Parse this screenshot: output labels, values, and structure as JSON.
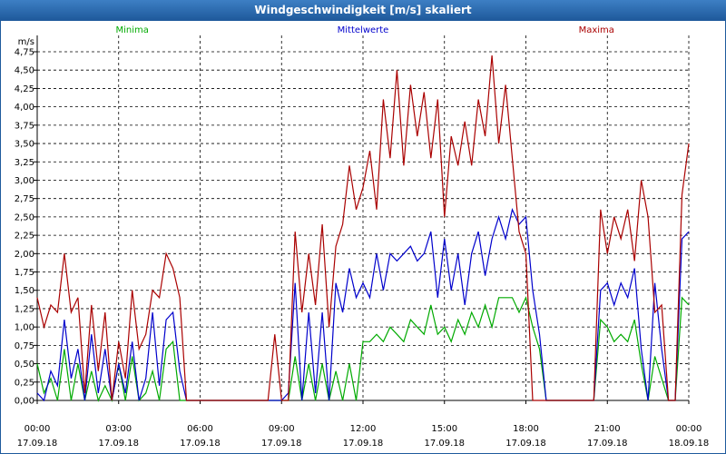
{
  "window": {
    "title": "Windgeschwindigkeit [m/s] skaliert"
  },
  "chart_data": {
    "type": "line",
    "title": "Windgeschwindigkeit [m/s] skaliert",
    "ylabel": "m/s",
    "ylim": [
      0,
      4.75
    ],
    "grid": true,
    "legend_position": "top",
    "y_ticks": [
      "0,00",
      "0,25",
      "0,50",
      "0,75",
      "1,00",
      "1,25",
      "1,50",
      "1,75",
      "2,00",
      "2,25",
      "2,50",
      "2,75",
      "3,00",
      "3,25",
      "3,50",
      "3,75",
      "4,00",
      "4,25",
      "4,50",
      "4,75"
    ],
    "x_ticks": [
      {
        "time": "00:00",
        "date": "17.09.18"
      },
      {
        "time": "03:00",
        "date": "17.09.18"
      },
      {
        "time": "06:00",
        "date": "17.09.18"
      },
      {
        "time": "09:00",
        "date": "17.09.18"
      },
      {
        "time": "12:00",
        "date": "17.09.18"
      },
      {
        "time": "15:00",
        "date": "17.09.18"
      },
      {
        "time": "18:00",
        "date": "17.09.18"
      },
      {
        "time": "21:00",
        "date": "17.09.18"
      },
      {
        "time": "00:00",
        "date": "18.09.18"
      }
    ],
    "x_range_hours": [
      0,
      24
    ],
    "series": [
      {
        "name": "Minima",
        "color": "#00aa00",
        "points": [
          [
            0,
            0.5
          ],
          [
            0.25,
            0.1
          ],
          [
            0.5,
            0.3
          ],
          [
            0.75,
            0.0
          ],
          [
            1,
            0.7
          ],
          [
            1.25,
            0.0
          ],
          [
            1.5,
            0.5
          ],
          [
            1.75,
            0.0
          ],
          [
            2,
            0.4
          ],
          [
            2.25,
            0.0
          ],
          [
            2.5,
            0.2
          ],
          [
            2.75,
            0.0
          ],
          [
            3,
            0.5
          ],
          [
            3.25,
            0.0
          ],
          [
            3.5,
            0.6
          ],
          [
            3.75,
            0.0
          ],
          [
            4,
            0.1
          ],
          [
            4.25,
            0.4
          ],
          [
            4.5,
            0.0
          ],
          [
            4.75,
            0.7
          ],
          [
            5,
            0.8
          ],
          [
            5.25,
            0.0
          ],
          [
            5.5,
            0.0
          ],
          [
            6,
            0.0
          ],
          [
            7,
            0.0
          ],
          [
            8,
            0.0
          ],
          [
            9,
            0.0
          ],
          [
            9.25,
            0.0
          ],
          [
            9.5,
            0.6
          ],
          [
            9.75,
            0.0
          ],
          [
            10,
            0.5
          ],
          [
            10.25,
            0.0
          ],
          [
            10.5,
            0.5
          ],
          [
            10.75,
            0.0
          ],
          [
            11,
            0.4
          ],
          [
            11.25,
            0.0
          ],
          [
            11.5,
            0.5
          ],
          [
            11.75,
            0.0
          ],
          [
            12,
            0.8
          ],
          [
            12.25,
            0.8
          ],
          [
            12.5,
            0.9
          ],
          [
            12.75,
            0.8
          ],
          [
            13,
            1.0
          ],
          [
            13.25,
            0.9
          ],
          [
            13.5,
            0.8
          ],
          [
            13.75,
            1.1
          ],
          [
            14,
            1.0
          ],
          [
            14.25,
            0.9
          ],
          [
            14.5,
            1.3
          ],
          [
            14.75,
            0.9
          ],
          [
            15,
            1.0
          ],
          [
            15.25,
            0.8
          ],
          [
            15.5,
            1.1
          ],
          [
            15.75,
            0.9
          ],
          [
            16,
            1.2
          ],
          [
            16.25,
            1.0
          ],
          [
            16.5,
            1.3
          ],
          [
            16.75,
            1.0
          ],
          [
            17,
            1.4
          ],
          [
            17.25,
            1.4
          ],
          [
            17.5,
            1.4
          ],
          [
            17.75,
            1.2
          ],
          [
            18,
            1.4
          ],
          [
            18.25,
            1.0
          ],
          [
            18.5,
            0.7
          ],
          [
            18.75,
            0.0
          ],
          [
            19,
            0.0
          ],
          [
            20,
            0.0
          ],
          [
            20.5,
            0.0
          ],
          [
            20.75,
            1.1
          ],
          [
            21,
            1.0
          ],
          [
            21.25,
            0.8
          ],
          [
            21.5,
            0.9
          ],
          [
            21.75,
            0.8
          ],
          [
            22,
            1.1
          ],
          [
            22.25,
            0.5
          ],
          [
            22.5,
            0.0
          ],
          [
            22.75,
            0.6
          ],
          [
            23,
            0.3
          ],
          [
            23.25,
            0.0
          ],
          [
            23.5,
            0.0
          ],
          [
            23.75,
            1.4
          ],
          [
            24,
            1.3
          ]
        ]
      },
      {
        "name": "Mittelwerte",
        "color": "#0000cc",
        "points": [
          [
            0,
            0.1
          ],
          [
            0.25,
            0.0
          ],
          [
            0.5,
            0.4
          ],
          [
            0.75,
            0.2
          ],
          [
            1,
            1.1
          ],
          [
            1.25,
            0.3
          ],
          [
            1.5,
            0.7
          ],
          [
            1.75,
            0.0
          ],
          [
            2,
            0.9
          ],
          [
            2.25,
            0.1
          ],
          [
            2.5,
            0.7
          ],
          [
            2.75,
            0.0
          ],
          [
            3,
            0.5
          ],
          [
            3.25,
            0.1
          ],
          [
            3.5,
            0.8
          ],
          [
            3.75,
            0.0
          ],
          [
            4,
            0.3
          ],
          [
            4.25,
            1.2
          ],
          [
            4.5,
            0.2
          ],
          [
            4.75,
            1.1
          ],
          [
            5,
            1.2
          ],
          [
            5.25,
            0.4
          ],
          [
            5.5,
            0.0
          ],
          [
            6,
            0.0
          ],
          [
            7,
            0.0
          ],
          [
            8,
            0.0
          ],
          [
            9,
            0.0
          ],
          [
            9.25,
            0.1
          ],
          [
            9.5,
            1.6
          ],
          [
            9.75,
            0.0
          ],
          [
            10,
            1.2
          ],
          [
            10.25,
            0.1
          ],
          [
            10.5,
            1.2
          ],
          [
            10.75,
            0.0
          ],
          [
            11,
            1.6
          ],
          [
            11.25,
            1.2
          ],
          [
            11.5,
            1.8
          ],
          [
            11.75,
            1.4
          ],
          [
            12,
            1.6
          ],
          [
            12.25,
            1.4
          ],
          [
            12.5,
            2.0
          ],
          [
            12.75,
            1.5
          ],
          [
            13,
            2.0
          ],
          [
            13.25,
            1.9
          ],
          [
            13.5,
            2.0
          ],
          [
            13.75,
            2.1
          ],
          [
            14,
            1.9
          ],
          [
            14.25,
            2.0
          ],
          [
            14.5,
            2.3
          ],
          [
            14.75,
            1.4
          ],
          [
            15,
            2.2
          ],
          [
            15.25,
            1.5
          ],
          [
            15.5,
            2.0
          ],
          [
            15.75,
            1.3
          ],
          [
            16,
            2.0
          ],
          [
            16.25,
            2.3
          ],
          [
            16.5,
            1.7
          ],
          [
            16.75,
            2.2
          ],
          [
            17,
            2.5
          ],
          [
            17.25,
            2.2
          ],
          [
            17.5,
            2.6
          ],
          [
            17.75,
            2.4
          ],
          [
            18,
            2.5
          ],
          [
            18.25,
            1.5
          ],
          [
            18.5,
            0.9
          ],
          [
            18.75,
            0.0
          ],
          [
            19,
            0.0
          ],
          [
            20,
            0.0
          ],
          [
            20.5,
            0.0
          ],
          [
            20.75,
            1.5
          ],
          [
            21,
            1.6
          ],
          [
            21.25,
            1.3
          ],
          [
            21.5,
            1.6
          ],
          [
            21.75,
            1.4
          ],
          [
            22,
            1.8
          ],
          [
            22.25,
            0.7
          ],
          [
            22.5,
            0.0
          ],
          [
            22.75,
            1.6
          ],
          [
            23,
            0.7
          ],
          [
            23.25,
            0.0
          ],
          [
            23.5,
            0.0
          ],
          [
            23.75,
            2.2
          ],
          [
            24,
            2.3
          ]
        ]
      },
      {
        "name": "Maxima",
        "color": "#aa0000",
        "points": [
          [
            0,
            1.4
          ],
          [
            0.25,
            1.0
          ],
          [
            0.5,
            1.3
          ],
          [
            0.75,
            1.2
          ],
          [
            1,
            2.0
          ],
          [
            1.25,
            1.2
          ],
          [
            1.5,
            1.4
          ],
          [
            1.75,
            0.1
          ],
          [
            2,
            1.3
          ],
          [
            2.25,
            0.4
          ],
          [
            2.5,
            1.2
          ],
          [
            2.75,
            0.0
          ],
          [
            3,
            0.8
          ],
          [
            3.25,
            0.3
          ],
          [
            3.5,
            1.5
          ],
          [
            3.75,
            0.7
          ],
          [
            4,
            0.9
          ],
          [
            4.25,
            1.5
          ],
          [
            4.5,
            1.4
          ],
          [
            4.75,
            2.0
          ],
          [
            5,
            1.8
          ],
          [
            5.25,
            1.4
          ],
          [
            5.5,
            0.0
          ],
          [
            6,
            0.0
          ],
          [
            7,
            0.0
          ],
          [
            8,
            0.0
          ],
          [
            8.5,
            0.0
          ],
          [
            8.75,
            0.9
          ],
          [
            9,
            0.0
          ],
          [
            9.25,
            0.0
          ],
          [
            9.5,
            2.3
          ],
          [
            9.75,
            1.2
          ],
          [
            10,
            2.0
          ],
          [
            10.25,
            1.3
          ],
          [
            10.5,
            2.4
          ],
          [
            10.75,
            1.0
          ],
          [
            11,
            2.1
          ],
          [
            11.25,
            2.4
          ],
          [
            11.5,
            3.2
          ],
          [
            11.75,
            2.6
          ],
          [
            12,
            2.9
          ],
          [
            12.25,
            3.4
          ],
          [
            12.5,
            2.6
          ],
          [
            12.75,
            4.1
          ],
          [
            13,
            3.3
          ],
          [
            13.25,
            4.5
          ],
          [
            13.5,
            3.2
          ],
          [
            13.75,
            4.3
          ],
          [
            14,
            3.6
          ],
          [
            14.25,
            4.2
          ],
          [
            14.5,
            3.3
          ],
          [
            14.75,
            4.1
          ],
          [
            15,
            2.5
          ],
          [
            15.25,
            3.6
          ],
          [
            15.5,
            3.2
          ],
          [
            15.75,
            3.8
          ],
          [
            16,
            3.2
          ],
          [
            16.25,
            4.1
          ],
          [
            16.5,
            3.6
          ],
          [
            16.75,
            4.7
          ],
          [
            17,
            3.5
          ],
          [
            17.25,
            4.3
          ],
          [
            17.5,
            3.3
          ],
          [
            17.75,
            2.3
          ],
          [
            18,
            2.0
          ],
          [
            18.25,
            0.0
          ],
          [
            19,
            0.0
          ],
          [
            20,
            0.0
          ],
          [
            20.5,
            0.0
          ],
          [
            20.75,
            2.6
          ],
          [
            21,
            2.0
          ],
          [
            21.25,
            2.5
          ],
          [
            21.5,
            2.2
          ],
          [
            21.75,
            2.6
          ],
          [
            22,
            1.9
          ],
          [
            22.25,
            3.0
          ],
          [
            22.5,
            2.5
          ],
          [
            22.75,
            1.2
          ],
          [
            23,
            1.3
          ],
          [
            23.25,
            0.0
          ],
          [
            23.5,
            0.0
          ],
          [
            23.75,
            2.8
          ],
          [
            24,
            3.5
          ]
        ]
      }
    ]
  }
}
